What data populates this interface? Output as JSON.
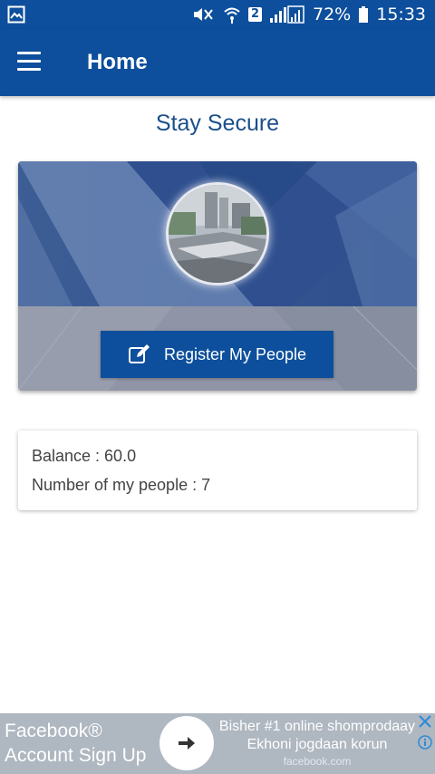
{
  "status_bar": {
    "battery": "72%",
    "time": "15:33",
    "sim_badge": "2"
  },
  "app_bar": {
    "title": "Home"
  },
  "main": {
    "heading": "Stay Secure",
    "register_button_label": "Register My People"
  },
  "info": {
    "balance": "Balance : 60.0",
    "people_count": "Number of my people : 7"
  },
  "ad": {
    "title_line1": "Facebook®",
    "title_line2": "Account Sign Up",
    "line1": "Bisher #1 online shomprodaay",
    "line2": "Ekhoni jogdaan korun",
    "domain": "facebook.com"
  },
  "icons": {
    "gallery": "gallery-icon",
    "mute": "mute-icon",
    "wifi": "wifi-icon",
    "signal": "signal-icon",
    "battery": "battery-icon",
    "menu": "menu-icon",
    "edit": "edit-icon",
    "arrow": "arrow-right-icon",
    "close": "close-icon",
    "info": "info-icon"
  },
  "colors": {
    "primary": "#0d4f9c",
    "heading": "#1b4f8c",
    "ad_background": "#afb7c1"
  }
}
